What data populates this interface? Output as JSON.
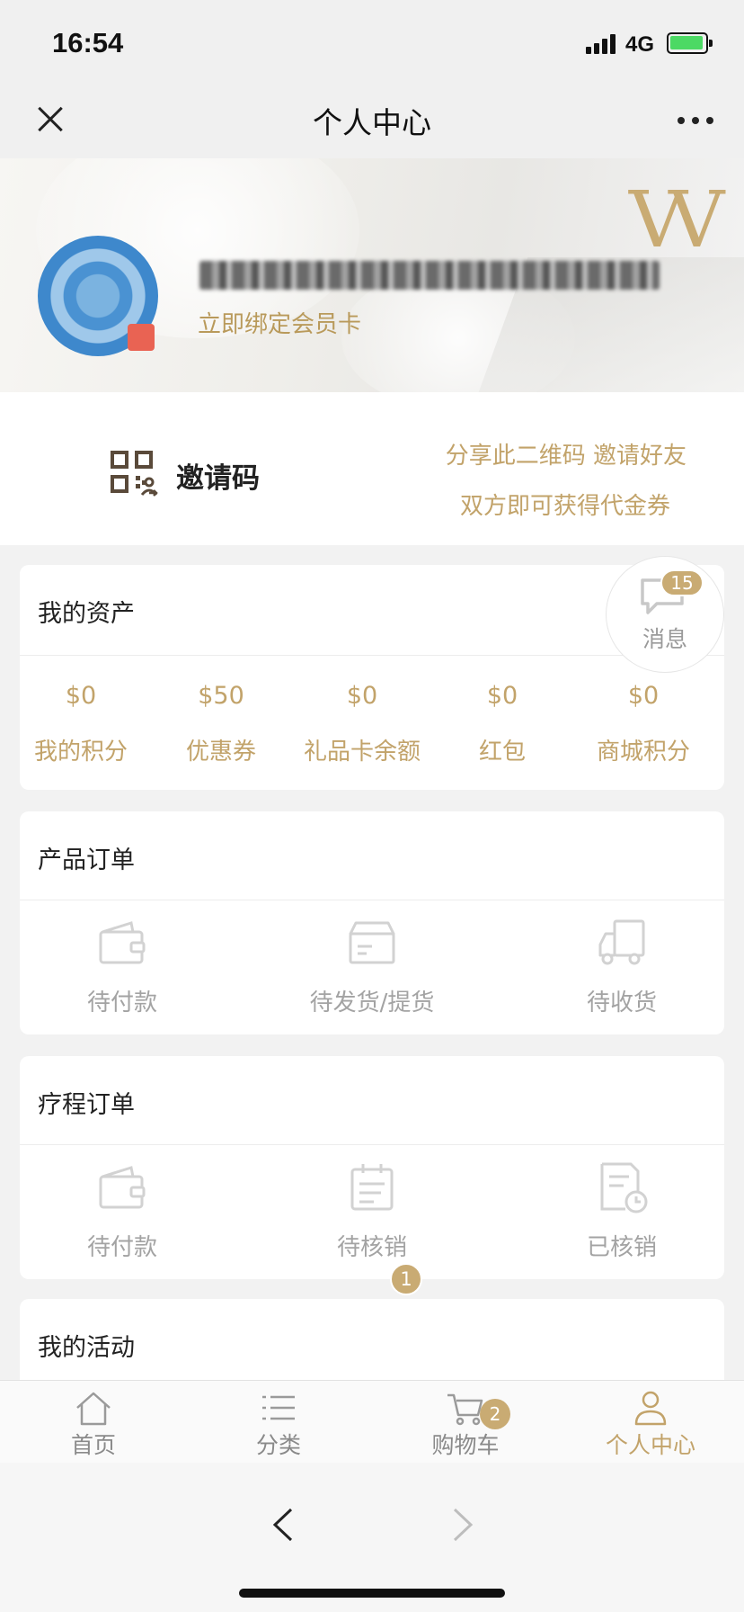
{
  "status_bar": {
    "time": "16:54",
    "network": "4G"
  },
  "nav": {
    "title": "个人中心"
  },
  "profile": {
    "bind_card_label": "立即绑定会员卡",
    "brand_logo": "VV"
  },
  "invite": {
    "label": "邀请码",
    "line1": "分享此二维码 邀请好友",
    "line2": "双方即可获得代金券"
  },
  "assets": {
    "title": "我的资产",
    "items": [
      {
        "value": "$0",
        "label": "我的积分"
      },
      {
        "value": "$50",
        "label": "优惠券"
      },
      {
        "value": "$0",
        "label": "礼品卡余额"
      },
      {
        "value": "$0",
        "label": "红包"
      },
      {
        "value": "$0",
        "label": "商城积分"
      }
    ]
  },
  "messages": {
    "label": "消息",
    "badge": "15"
  },
  "product_orders": {
    "title": "产品订单",
    "items": [
      {
        "label": "待付款",
        "icon": "wallet-icon"
      },
      {
        "label": "待发货/提货",
        "icon": "box-icon"
      },
      {
        "label": "待收货",
        "icon": "truck-icon"
      }
    ]
  },
  "therapy_orders": {
    "title": "疗程订单",
    "items": [
      {
        "label": "待付款",
        "icon": "wallet-icon"
      },
      {
        "label": "待核销",
        "icon": "clipboard-icon",
        "badge": "1"
      },
      {
        "label": "已核销",
        "icon": "document-clock-icon"
      }
    ]
  },
  "activities": {
    "title": "我的活动"
  },
  "tabbar": {
    "items": [
      {
        "label": "首页",
        "icon": "home-icon"
      },
      {
        "label": "分类",
        "icon": "list-icon"
      },
      {
        "label": "购物车",
        "icon": "cart-icon",
        "badge": "2"
      },
      {
        "label": "个人中心",
        "icon": "user-icon",
        "active": true
      }
    ]
  },
  "colors": {
    "accent": "#c2a36a",
    "badge": "#c9ab73",
    "background": "#f2f2f2",
    "muted_icon": "#c8c8c8"
  }
}
